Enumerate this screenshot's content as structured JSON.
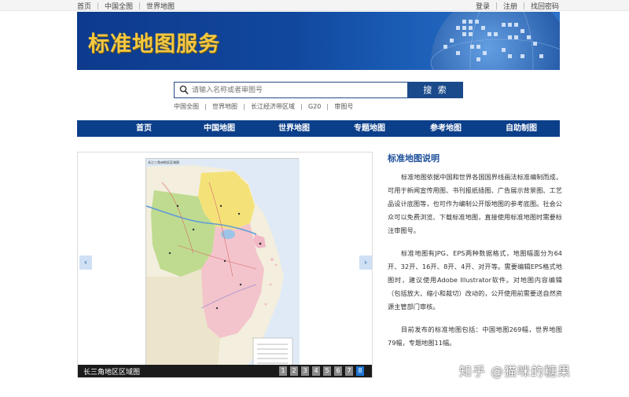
{
  "topbar": {
    "left_links": [
      "首页",
      "中国全图",
      "世界地图"
    ],
    "right_links": [
      "登录",
      "注册",
      "找回密码"
    ]
  },
  "banner": {
    "title": "标准地图服务"
  },
  "search": {
    "placeholder": "请输入名称或者审图号",
    "button_label": "搜 索"
  },
  "quick_links": [
    "中国全图",
    "世界地图",
    "长江经济带区域",
    "G20",
    "审图号"
  ],
  "nav": [
    "首页",
    "中国地图",
    "世界地图",
    "专题地图",
    "参考地图",
    "自助制图"
  ],
  "slider": {
    "map_title": "长江三角洲地区区域图",
    "caption": "长三角地区区域图",
    "pages": [
      "1",
      "2",
      "3",
      "4",
      "5",
      "6",
      "7",
      "8"
    ],
    "active_page": "8",
    "prev_icon": "‹",
    "next_icon": "›"
  },
  "info": {
    "heading": "标准地图说明",
    "paragraphs": [
      "标准地图依据中国和世界各国国界线画法标准编制而成，可用于新闻宣传用图、书刊报纸插图、广告展示背景图、工艺品设计底图等，也可作为编制公开版地图的参考底图。社会公众可以免费浏览、下载标准地图，直接使用标准地图时需要标注审图号。",
      "标准地图有JPG、EPS两种数据格式，地图幅面分为64开、32开、16开、8开、4开、对开等。需要编辑EPS格式地图时，建议使用Adobe Illustrator软件。对地图内容编辑（包括放大、缩小和裁切）改动的，公开使用前需要送自然资源主管部门审核。",
      "目前发布的标准地图包括：中国地图269幅，世界地图79幅，专题地图11幅。"
    ]
  },
  "watermark": "知乎 @猫咪的糖果",
  "colors": {
    "nav_blue": "#0c3f8a",
    "title_gold": "#f2c744",
    "heading_blue": "#1c4f9a",
    "active_page": "#1e77d4"
  }
}
